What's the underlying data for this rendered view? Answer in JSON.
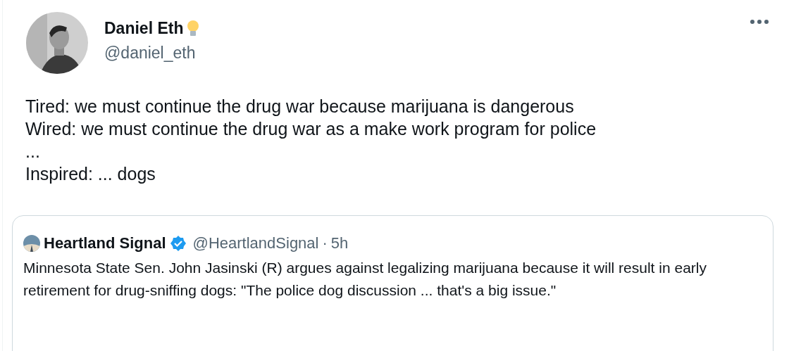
{
  "author": {
    "name": "Daniel Eth",
    "handle": "@daniel_eth"
  },
  "text": "Tired: we must continue the drug war because marijuana is dangerous\nWired: we must continue the drug war as a make work program for police\n...\nInspired: ... dogs",
  "quoted": {
    "name": "Heartland Signal",
    "verified": true,
    "handle": "@HeartlandSignal",
    "separator": "·",
    "time": "5h",
    "text": "Minnesota State Sen. John Jasinski (R) argues against legalizing marijuana because it will result in early retirement for drug-sniffing dogs: \"The police dog discussion ... that's a big issue.\""
  }
}
